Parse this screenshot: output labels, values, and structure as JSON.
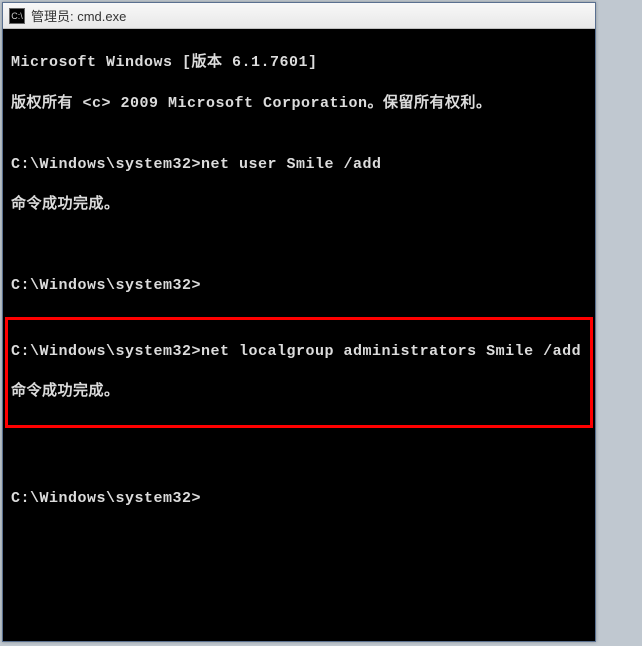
{
  "window": {
    "title": "管理员: cmd.exe",
    "icon_label": "C:\\"
  },
  "console": {
    "line1": "Microsoft Windows [版本 6.1.7601]",
    "line2": "版权所有 <c> 2009 Microsoft Corporation。保留所有权利。",
    "line3_prompt": "C:\\Windows\\system32>",
    "line3_cmd": "net user Smile /add",
    "line4": "命令成功完成。",
    "line5_prompt": "C:\\Windows\\system32>",
    "hl_prompt": "C:\\Windows\\system32>",
    "hl_cmd": "net localgroup administrators Smile /add",
    "hl_result": "命令成功完成。",
    "line6_prompt": "C:\\Windows\\system32>"
  }
}
